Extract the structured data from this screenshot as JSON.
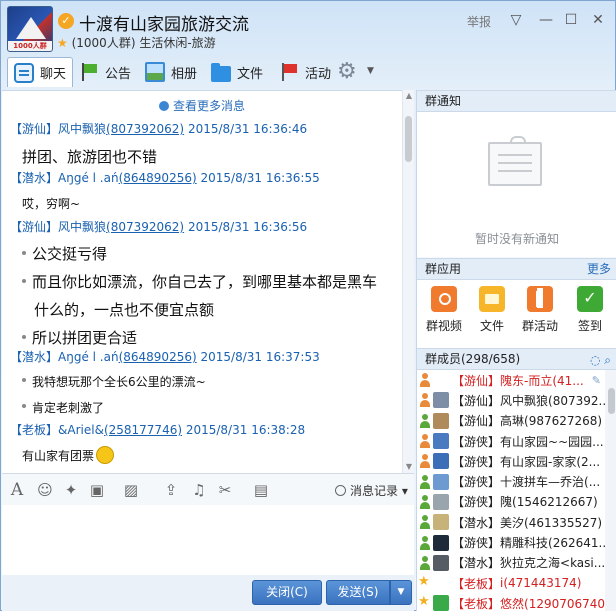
{
  "header": {
    "title": "十渡有山家园旅游交流",
    "member_count": "(1000人群)",
    "category": "生活休闲-旅游",
    "report_label": "举报",
    "logo_text": "1000人群"
  },
  "toolbar": {
    "tabs": [
      {
        "label": "聊天",
        "icon": "chat-icon"
      },
      {
        "label": "公告",
        "icon": "flag-icon"
      },
      {
        "label": "相册",
        "icon": "photo-icon"
      },
      {
        "label": "文件",
        "icon": "folder-icon"
      },
      {
        "label": "活动",
        "icon": "red-flag-icon"
      }
    ],
    "active_tab": "聊天"
  },
  "chat": {
    "load_more": "查看更多消息",
    "messages": [
      {
        "rank": "【游仙】",
        "name": "风中飘狼",
        "id": "(807392062)",
        "time": "2015/8/31 16:36:46",
        "lines": [
          "拼团、旅游团也不错"
        ]
      },
      {
        "rank": "【潜水】",
        "name": "Aŋgé l .ań",
        "id": "(864890256)",
        "time": "2015/8/31 16:36:55",
        "lines": [
          "哎，穷啊~"
        ]
      },
      {
        "rank": "【游仙】",
        "name": "风中飘狼",
        "id": "(807392062)",
        "time": "2015/8/31 16:36:56",
        "lines": [
          "公交挺亏得",
          "而且你比如漂流，你自己去了，到哪里基本都是黑车",
          "什么的，一点也不便宜点额",
          "所以拼团更合适"
        ]
      },
      {
        "rank": "【潜水】",
        "name": "Aŋgé l .ań",
        "id": "(864890256)",
        "time": "2015/8/31 16:37:53",
        "lines": [
          "我特想玩那个全长6公里的漂流~",
          "肯定老刺激了"
        ]
      },
      {
        "rank": "【老板】",
        "name": "&Ariel&",
        "id": "(258177746)",
        "time": "2015/8/31 16:38:28",
        "lines": [
          "有山家有团票"
        ]
      }
    ]
  },
  "input_toolbar": {
    "history_label": "消息记录"
  },
  "buttons": {
    "close": "关闭(C)",
    "send": "发送(S)"
  },
  "right_panel": {
    "notice_title": "群通知",
    "notice_empty": "暂时没有新通知",
    "apps_title": "群应用",
    "apps_more": "更多",
    "apps": [
      {
        "label": "群视频",
        "icon": "video-icon"
      },
      {
        "label": "文件",
        "icon": "file-icon"
      },
      {
        "label": "群活动",
        "icon": "activity-icon"
      },
      {
        "label": "签到",
        "icon": "signin-icon"
      }
    ],
    "members_title": "群成员(298/658)",
    "members": [
      {
        "rank": "【游仙】",
        "name": "隗东-而立(41...",
        "red": true,
        "user": "orange",
        "avatar": ""
      },
      {
        "rank": "【游仙】",
        "name": "风中飘狼(807392...",
        "red": false,
        "user": "orange",
        "avatar": "#7d8fa6"
      },
      {
        "rank": "【游仙】",
        "name": "高琳(987627268)",
        "red": false,
        "user": "green",
        "avatar": "#b08a5a"
      },
      {
        "rank": "【游侠】",
        "name": "有山家园~~园园...",
        "red": false,
        "user": "orange",
        "avatar": "#4a7bc0"
      },
      {
        "rank": "【游侠】",
        "name": "有山家园-家家(2...",
        "red": false,
        "user": "orange",
        "avatar": "#3d6fb8"
      },
      {
        "rank": "【游侠】",
        "name": "十渡拼车—乔治(...",
        "red": false,
        "user": "green",
        "avatar": "#6d9bd1"
      },
      {
        "rank": "【游侠】",
        "name": "隗(1546212667)",
        "red": false,
        "user": "green",
        "avatar": "#9aa4ad"
      },
      {
        "rank": "【潜水】",
        "name": "美汐(461335527)",
        "red": false,
        "user": "green",
        "avatar": "#c7b37a"
      },
      {
        "rank": "【游侠】",
        "name": "精雕科技(262641...",
        "red": false,
        "user": "green",
        "avatar": "#1e2a3a"
      },
      {
        "rank": "【潜水】",
        "name": "狄拉克之海<kasi...",
        "red": false,
        "user": "green",
        "avatar": "#555c63"
      },
      {
        "rank": "【老板】",
        "name": "i(471443174)",
        "red": true,
        "user": "star",
        "avatar": ""
      },
      {
        "rank": "【老板】",
        "name": "悠然(1290706740)",
        "red": true,
        "user": "star",
        "avatar": "#3aa94a"
      }
    ]
  }
}
